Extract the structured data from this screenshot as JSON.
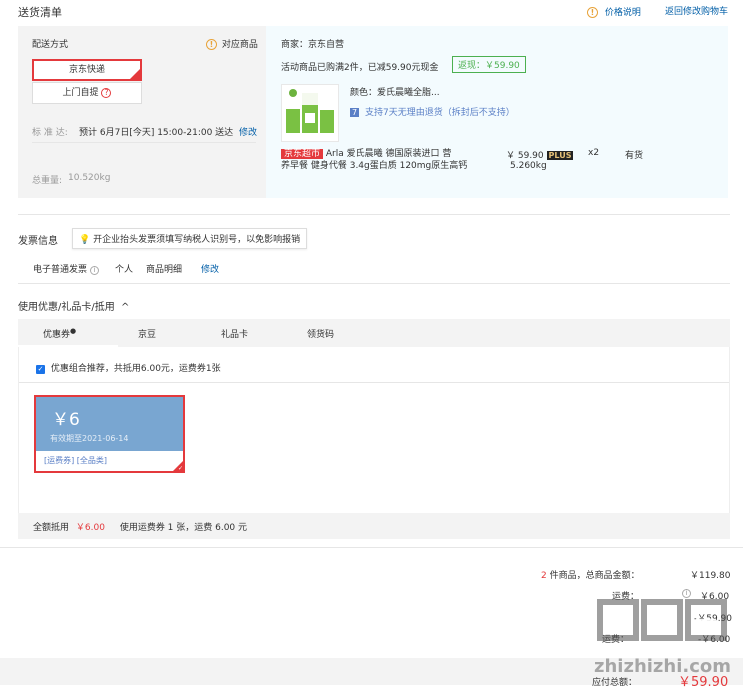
{
  "header": {
    "title": "送货清单",
    "price_note": "价格说明",
    "back_to_cart": "返回修改购物车"
  },
  "delivery": {
    "method_label": "配送方式",
    "matching_goods": "对应商品",
    "option_selected": "京东快递",
    "option_pickup": "上门自提",
    "schedule_label": "标 准 达:",
    "schedule_value": "预计 6月7日[今天] 15:00-21:00 送达",
    "modify": "修改",
    "weight_label": "总重量:",
    "weight_value": "10.520kg"
  },
  "merchant": {
    "label": "商家：京东自营",
    "promo": "活动商品已购满2件，已减59.90元现金",
    "rebate": "返现：￥59.90",
    "color": "颜色：爱氏晨曦全脂...",
    "return_policy": "支持7天无理由退货（拆封后不支持）",
    "market_badge": "京东超市",
    "product_name_line1": "Arla 爱氏晨曦 德国原装进口 营",
    "product_name_line2": "养早餐 健身代餐 3.4g蛋白质 120mg原生高钙",
    "price": "￥ 59.90",
    "plus": "PLUS",
    "qty": "x2",
    "stock": "有货",
    "weight": "5.260kg"
  },
  "invoice": {
    "title": "发票信息",
    "tip": "开企业抬头发票须填写纳税人识别号，以免影响报销",
    "type": "电子普通发票",
    "personal": "个人",
    "detail": "商品明细",
    "modify": "修改"
  },
  "coupons": {
    "section_title": "使用优惠/礼品卡/抵用",
    "tabs": [
      "优惠券",
      "京豆",
      "礼品卡",
      "领货码"
    ],
    "combo_text": "优惠组合推荐，共抵用6.00元，运费券1张",
    "card_amount": "￥6",
    "card_expiry": "有效期至2021-06-14",
    "card_tag1": "[运费券]",
    "card_tag2": "[全品类]",
    "footer_prefix": "全额抵用",
    "footer_amount": "￥6.00",
    "footer_suffix": "使用运费券 1 张，运费 6.00 元"
  },
  "summary": {
    "count": "2",
    "count_label": "件商品，总商品金额：",
    "total": "￥119.80",
    "freight_label": "运费：",
    "freight": "￥6.00",
    "row3_label": "",
    "row3_value": "-￥59.90",
    "row4_label": "运费：",
    "row4_value": "-￥6.00",
    "pay_label": "应付总额：",
    "pay_value": "￥59.90"
  },
  "watermark": {
    "logo": "值|值|值",
    "site": "zhizhizhi.com"
  },
  "colors": {
    "accent_red": "#e4393c",
    "link_blue": "#005ea7",
    "rebate_green": "#4cb050",
    "coupon_blue": "#79a6d1"
  }
}
